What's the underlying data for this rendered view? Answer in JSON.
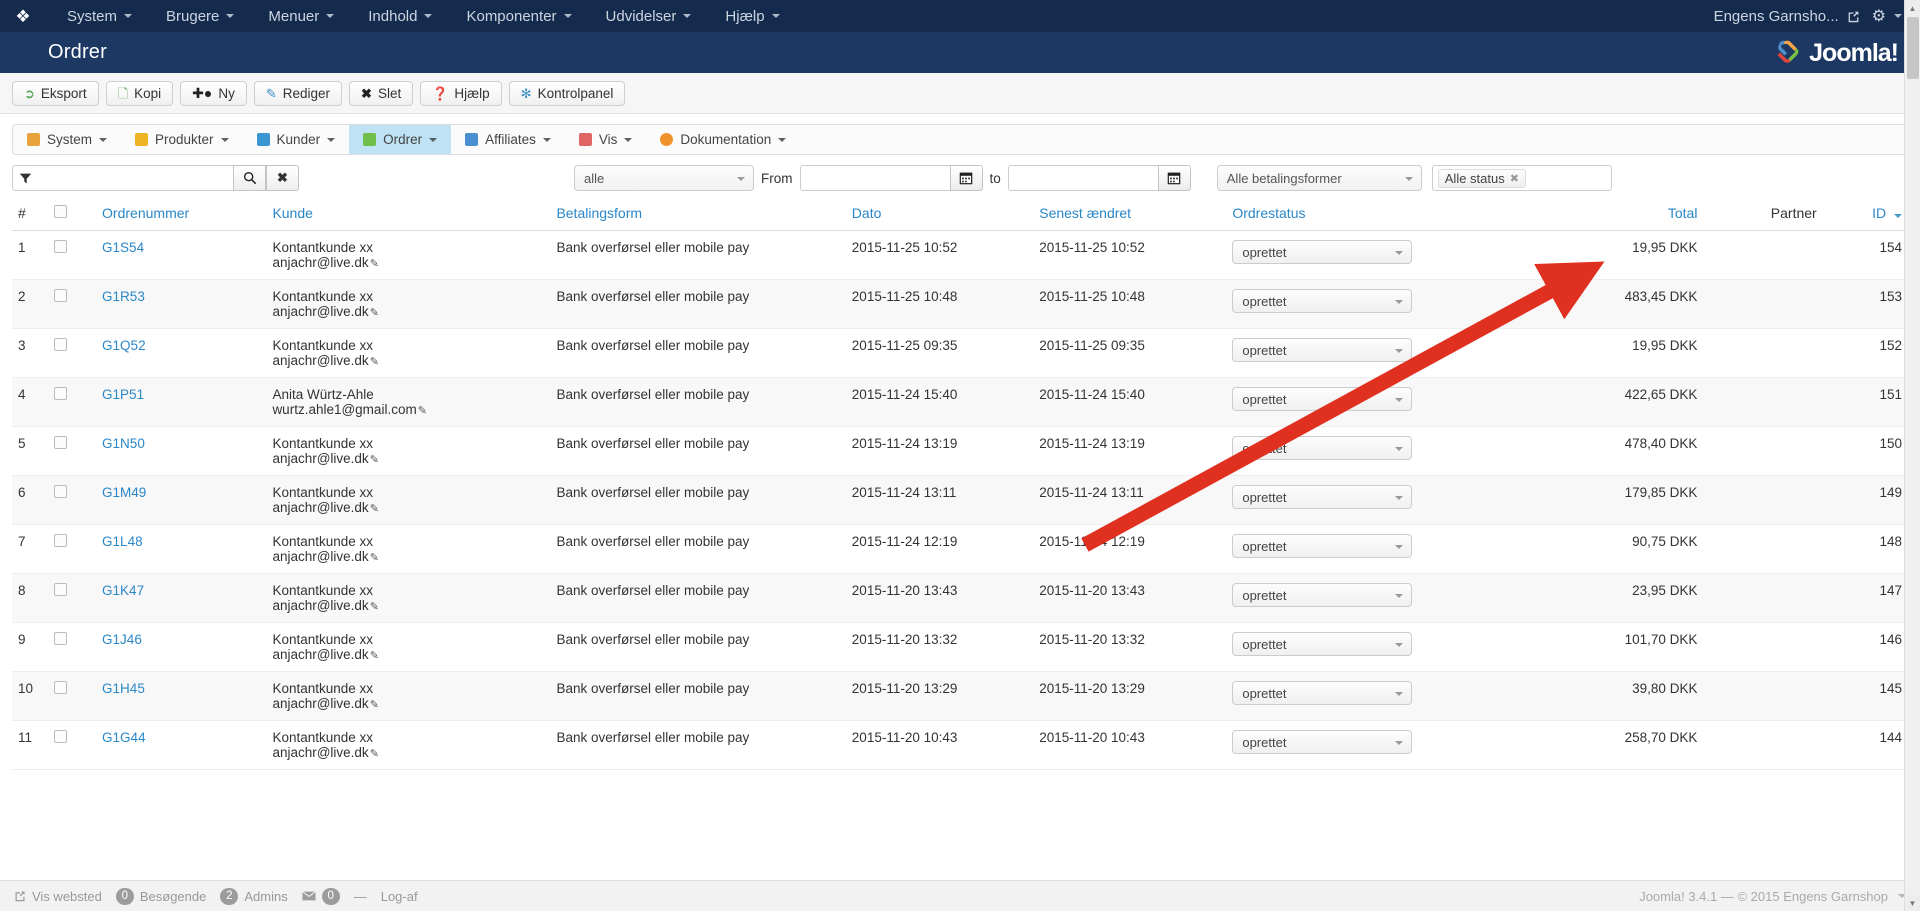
{
  "topbar": {
    "brand_icon": "joomla-mark-icon",
    "menu": [
      {
        "label": "System"
      },
      {
        "label": "Brugere"
      },
      {
        "label": "Menuer"
      },
      {
        "label": "Indhold"
      },
      {
        "label": "Komponenter"
      },
      {
        "label": "Udvidelser"
      },
      {
        "label": "Hjælp"
      }
    ],
    "user": "Engens Garnsho...",
    "gear_icon": "gear-icon"
  },
  "header": {
    "title": "Ordrer",
    "logo_text": "Joomla!"
  },
  "toolbar": {
    "buttons": [
      {
        "label": "Eksport",
        "icon": "export-icon"
      },
      {
        "label": "Kopi",
        "icon": "copy-icon"
      },
      {
        "label": "Ny",
        "icon": "plus-icon"
      },
      {
        "label": "Rediger",
        "icon": "edit-icon"
      },
      {
        "label": "Slet",
        "icon": "delete-icon"
      },
      {
        "label": "Hjælp",
        "icon": "help-icon"
      },
      {
        "label": "Kontrolpanel",
        "icon": "control-panel-icon"
      }
    ]
  },
  "submenu": {
    "items": [
      {
        "label": "System",
        "icon": "tools-icon",
        "color": "#e8a33d",
        "active": false
      },
      {
        "label": "Produkter",
        "icon": "box-icon",
        "color": "#f0b323",
        "active": false
      },
      {
        "label": "Kunder",
        "icon": "users-icon",
        "color": "#3b97d3",
        "active": false
      },
      {
        "label": "Ordrer",
        "icon": "orders-icon",
        "color": "#6fbf4a",
        "active": true
      },
      {
        "label": "Affiliates",
        "icon": "affiliate-icon",
        "color": "#4a8fd0",
        "active": false
      },
      {
        "label": "Vis",
        "icon": "view-icon",
        "color": "#e06666",
        "active": false
      },
      {
        "label": "Dokumentation",
        "icon": "docs-icon",
        "color": "#f0932b",
        "active": false
      }
    ]
  },
  "filters": {
    "filter_icon": "funnel-icon",
    "search_value": "",
    "search_placeholder": "",
    "search_icon": "search-icon",
    "clear_icon": "clear-icon",
    "period_select": "alle",
    "from_label": "From",
    "from_value": "",
    "to_label": "to",
    "to_value": "",
    "calendar_icon": "calendar-icon",
    "payment_select": "Alle betalingsformer",
    "status_chip": "Alle status",
    "status_chip_remove_icon": "remove-chip-icon"
  },
  "table": {
    "columns": [
      {
        "label": "#",
        "link": false
      },
      {
        "label": "",
        "link": false
      },
      {
        "label": "Ordrenummer",
        "link": true
      },
      {
        "label": "Kunde",
        "link": true
      },
      {
        "label": "Betalingsform",
        "link": true
      },
      {
        "label": "Dato",
        "link": true
      },
      {
        "label": "Senest ændret",
        "link": true
      },
      {
        "label": "Ordrestatus",
        "link": true
      },
      {
        "label": "Total",
        "link": true
      },
      {
        "label": "Partner",
        "link": false
      },
      {
        "label": "ID",
        "link": true
      }
    ],
    "sort_column": "ID",
    "sort_icon": "sort-desc-icon",
    "rows": [
      {
        "num": "1",
        "order_no": "G1S54",
        "customer": "Kontantkunde xx",
        "email": "anjachr@live.dk",
        "payment": "Bank overførsel eller mobile pay",
        "date": "2015-11-25 10:52",
        "modified": "2015-11-25 10:52",
        "status": "oprettet",
        "total": "19,95 DKK",
        "partner": "",
        "id": "154"
      },
      {
        "num": "2",
        "order_no": "G1R53",
        "customer": "Kontantkunde xx",
        "email": "anjachr@live.dk",
        "payment": "Bank overførsel eller mobile pay",
        "date": "2015-11-25 10:48",
        "modified": "2015-11-25 10:48",
        "status": "oprettet",
        "total": "483,45 DKK",
        "partner": "",
        "id": "153"
      },
      {
        "num": "3",
        "order_no": "G1Q52",
        "customer": "Kontantkunde xx",
        "email": "anjachr@live.dk",
        "payment": "Bank overførsel eller mobile pay",
        "date": "2015-11-25 09:35",
        "modified": "2015-11-25 09:35",
        "status": "oprettet",
        "total": "19,95 DKK",
        "partner": "",
        "id": "152"
      },
      {
        "num": "4",
        "order_no": "G1P51",
        "customer": "Anita Würtz-Ahle",
        "email": "wurtz.ahle1@gmail.com",
        "payment": "Bank overførsel eller mobile pay",
        "date": "2015-11-24 15:40",
        "modified": "2015-11-24 15:40",
        "status": "oprettet",
        "total": "422,65 DKK",
        "partner": "",
        "id": "151"
      },
      {
        "num": "5",
        "order_no": "G1N50",
        "customer": "Kontantkunde xx",
        "email": "anjachr@live.dk",
        "payment": "Bank overførsel eller mobile pay",
        "date": "2015-11-24 13:19",
        "modified": "2015-11-24 13:19",
        "status": "oprettet",
        "total": "478,40 DKK",
        "partner": "",
        "id": "150"
      },
      {
        "num": "6",
        "order_no": "G1M49",
        "customer": "Kontantkunde xx",
        "email": "anjachr@live.dk",
        "payment": "Bank overførsel eller mobile pay",
        "date": "2015-11-24 13:11",
        "modified": "2015-11-24 13:11",
        "status": "oprettet",
        "total": "179,85 DKK",
        "partner": "",
        "id": "149"
      },
      {
        "num": "7",
        "order_no": "G1L48",
        "customer": "Kontantkunde xx",
        "email": "anjachr@live.dk",
        "payment": "Bank overførsel eller mobile pay",
        "date": "2015-11-24 12:19",
        "modified": "2015-11-24 12:19",
        "status": "oprettet",
        "total": "90,75 DKK",
        "partner": "",
        "id": "148"
      },
      {
        "num": "8",
        "order_no": "G1K47",
        "customer": "Kontantkunde xx",
        "email": "anjachr@live.dk",
        "payment": "Bank overførsel eller mobile pay",
        "date": "2015-11-20 13:43",
        "modified": "2015-11-20 13:43",
        "status": "oprettet",
        "total": "23,95 DKK",
        "partner": "",
        "id": "147"
      },
      {
        "num": "9",
        "order_no": "G1J46",
        "customer": "Kontantkunde xx",
        "email": "anjachr@live.dk",
        "payment": "Bank overførsel eller mobile pay",
        "date": "2015-11-20 13:32",
        "modified": "2015-11-20 13:32",
        "status": "oprettet",
        "total": "101,70 DKK",
        "partner": "",
        "id": "146"
      },
      {
        "num": "10",
        "order_no": "G1H45",
        "customer": "Kontantkunde xx",
        "email": "anjachr@live.dk",
        "payment": "Bank overførsel eller mobile pay",
        "date": "2015-11-20 13:29",
        "modified": "2015-11-20 13:29",
        "status": "oprettet",
        "total": "39,80 DKK",
        "partner": "",
        "id": "145"
      },
      {
        "num": "11",
        "order_no": "G1G44",
        "customer": "Kontantkunde xx",
        "email": "anjachr@live.dk",
        "payment": "Bank overførsel eller mobile pay",
        "date": "2015-11-20 10:43",
        "modified": "2015-11-20 10:43",
        "status": "oprettet",
        "total": "258,70 DKK",
        "partner": "",
        "id": "144"
      }
    ]
  },
  "footer": {
    "view_site": "Vis websted",
    "visitors_count": "0",
    "visitors_label": "Besøgende",
    "admins_count": "2",
    "admins_label": "Admins",
    "messages_count": "0",
    "messages_icon": "envelope-icon",
    "separator": "—",
    "logout": "Log-af",
    "version": "Joomla! 3.4.1  —  © 2015 Engens Garnshop"
  },
  "annotation": {
    "arrow_color": "#e03020",
    "description": "red arrow pointing to total value"
  },
  "scrollbar": {
    "up_icon": "scroll-up-icon",
    "down_icon": "scroll-down-icon"
  }
}
